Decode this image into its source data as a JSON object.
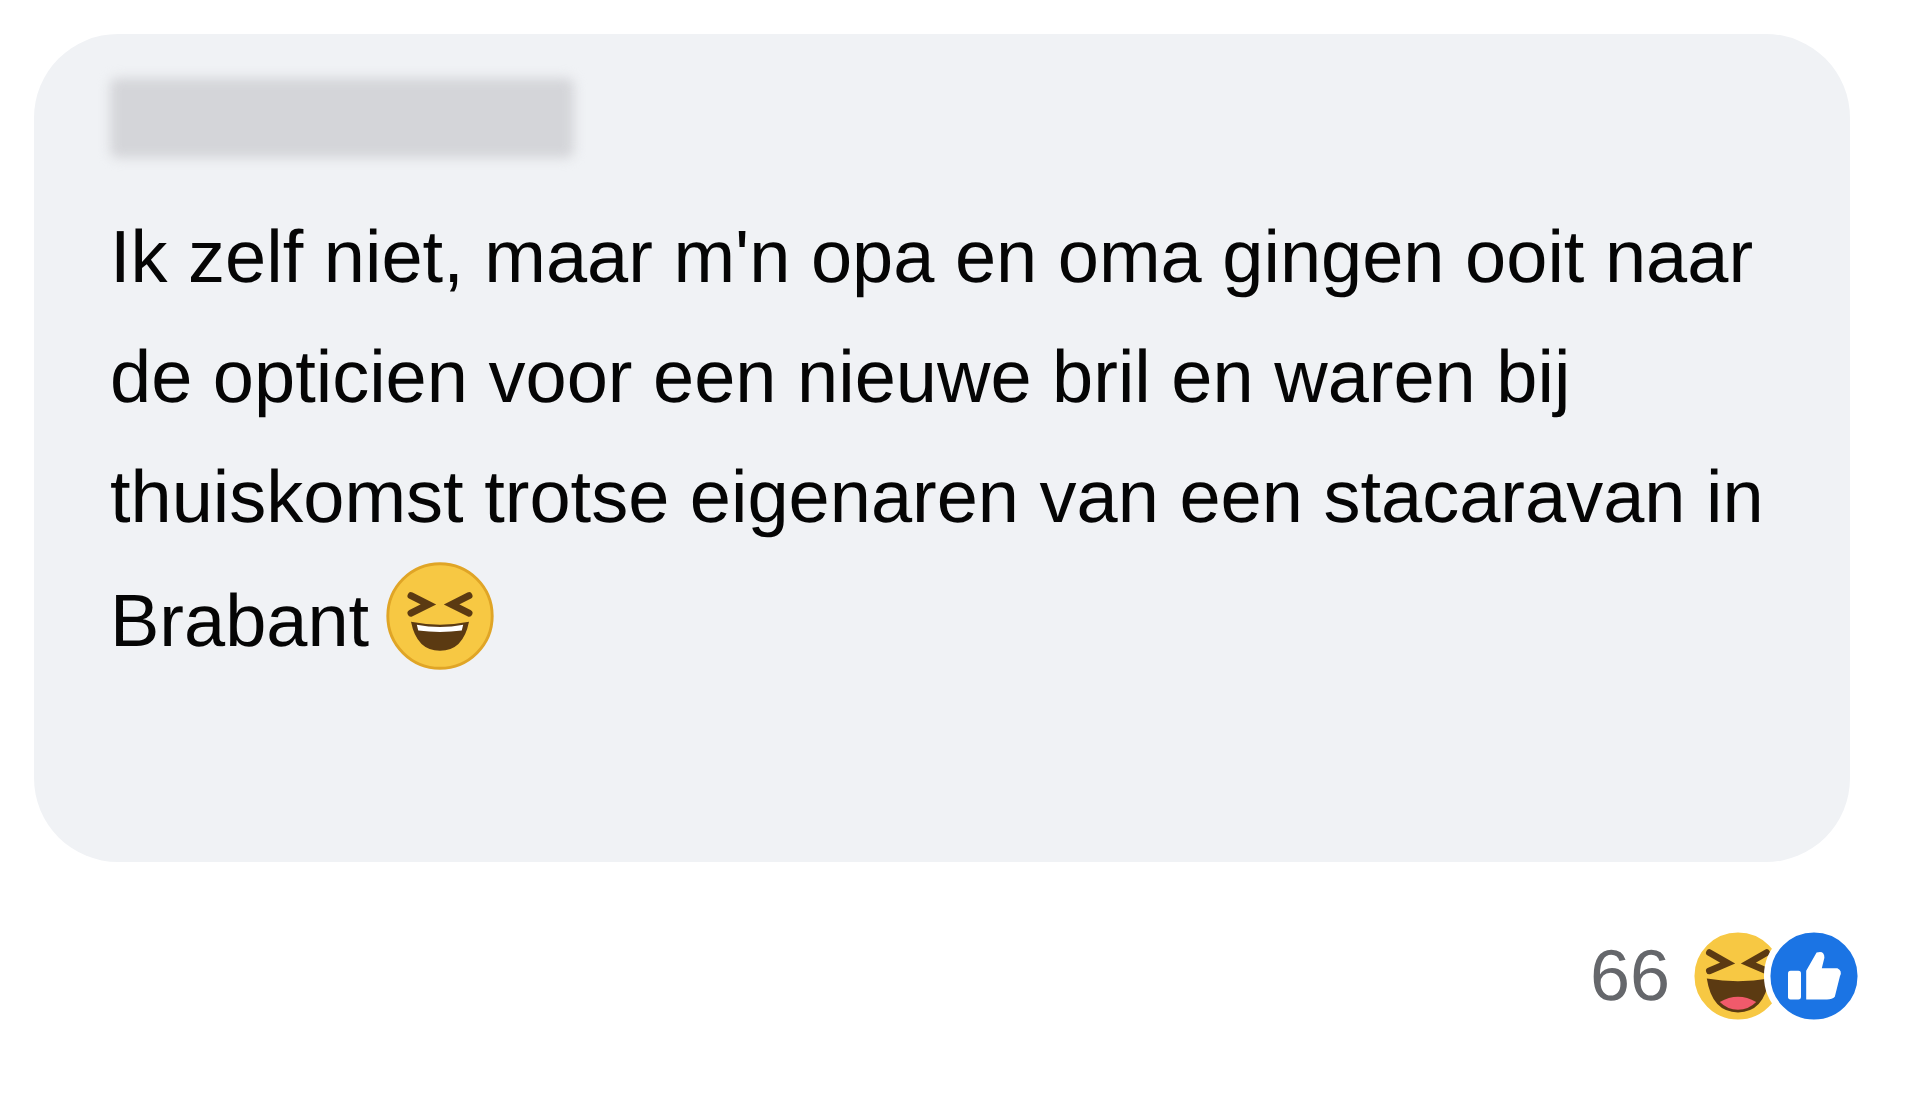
{
  "comment": {
    "text": "Ik zelf niet, maar m'n opa en oma gingen ooit naar de opticien voor een nieuwe bril en waren bij thuiskomst trotse eigenaren van een stacaravan in Brabant"
  },
  "reactions": {
    "count": "66",
    "items": [
      {
        "kind": "haha"
      },
      {
        "kind": "like"
      }
    ]
  }
}
